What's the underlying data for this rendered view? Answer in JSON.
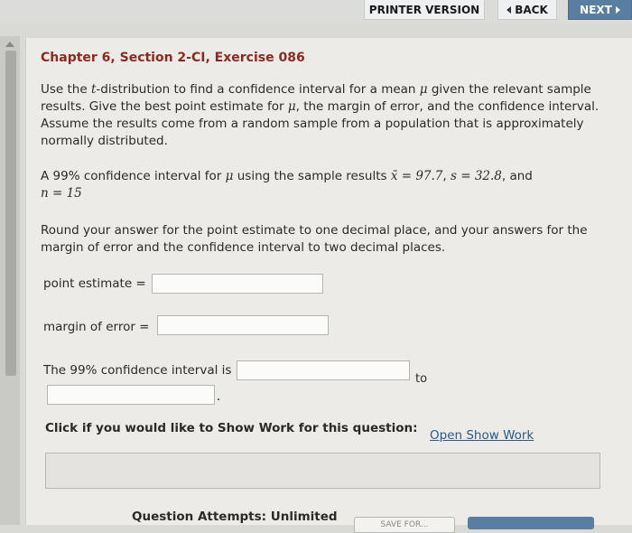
{
  "toolbar": {
    "printer_label": "PRINTER VERSION",
    "back_label": "BACK",
    "next_label": "NEXT"
  },
  "exercise": {
    "title": "Chapter 6, Section 2-CI, Exercise 086",
    "instructions_a": "Use the ",
    "instructions_t": "t",
    "instructions_b": "-distribution to find a confidence interval for a mean ",
    "mu": "μ",
    "instructions_c": " given the relevant sample results. Give the best point estimate for ",
    "instructions_d": ", the margin of error, and the confidence interval. Assume the results come from a random sample from a population that is approximately normally distributed.",
    "problem_a": "A ",
    "conf_level": "99%",
    "problem_b": " confidence interval for ",
    "problem_c": " using the sample results ",
    "xbar_expr": "x̄ = 97.7",
    "sep": ", ",
    "s_expr": "s = 32.8",
    "and": ", and",
    "n_expr": "n = 15",
    "rounding": "Round your answer for the point estimate to one decimal place, and your answers for the margin of error and the confidence interval to two decimal places."
  },
  "form": {
    "point_estimate_label": "point estimate =",
    "margin_label": "margin of error =",
    "interval_label_a": "The ",
    "interval_label_conf": "99%",
    "interval_label_b": " confidence interval is",
    "to_label": "to",
    "period": "."
  },
  "show_work": {
    "prompt": "Click if you would like to Show Work for this question:",
    "link": "Open Show Work"
  },
  "footer": {
    "attempts": "Question Attempts: Unlimited",
    "save_label": "SAVE FOR..."
  }
}
